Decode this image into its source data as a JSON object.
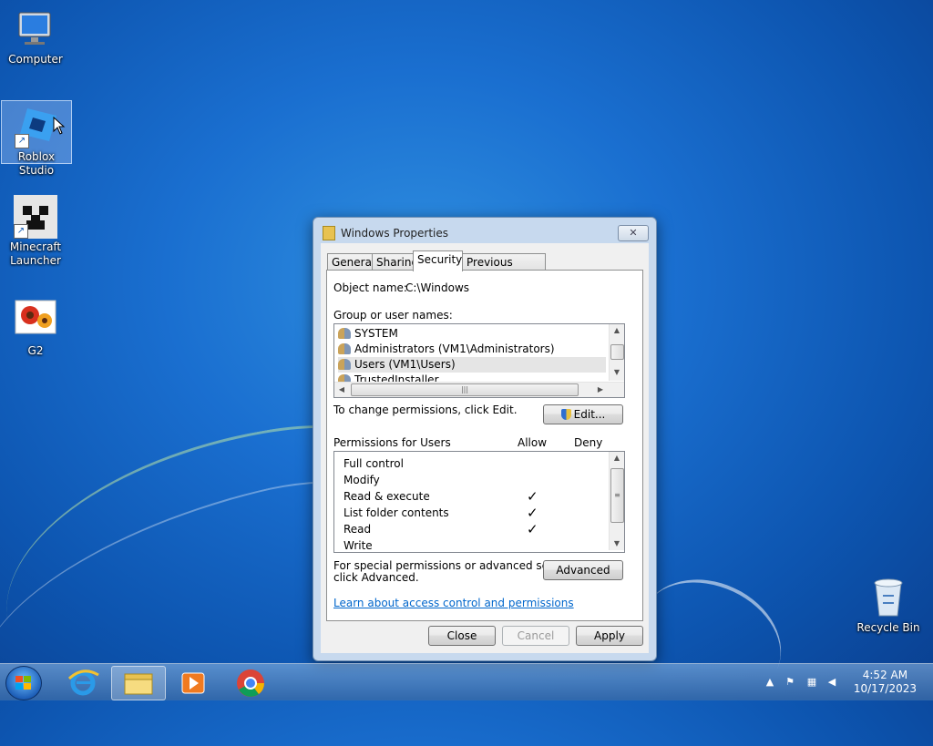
{
  "desktop": {
    "icons": [
      {
        "label": "Computer"
      },
      {
        "label": "Roblox Studio"
      },
      {
        "label": "Minecraft\nLauncher"
      },
      {
        "label": "G2"
      },
      {
        "label": "Recycle Bin"
      }
    ]
  },
  "dialog": {
    "title": "Windows Properties",
    "close_glyph": "✕",
    "tabs": [
      "General",
      "Sharing",
      "Security",
      "Previous Versions"
    ],
    "active_tab": "Security",
    "object_name_label": "Object name:",
    "object_name_value": "C:\\Windows",
    "group_label": "Group or user names:",
    "users": [
      {
        "name": "SYSTEM"
      },
      {
        "name": "Administrators (VM1\\Administrators)"
      },
      {
        "name": "Users (VM1\\Users)",
        "selected": true
      },
      {
        "name": "TrustedInstaller"
      }
    ],
    "change_text": "To change permissions, click Edit.",
    "edit_button": "Edit...",
    "permissions_label": "Permissions for Users",
    "allow_header": "Allow",
    "deny_header": "Deny",
    "permissions": [
      {
        "name": "Full control",
        "allow": false,
        "deny": false
      },
      {
        "name": "Modify",
        "allow": false,
        "deny": false
      },
      {
        "name": "Read & execute",
        "allow": true,
        "deny": false
      },
      {
        "name": "List folder contents",
        "allow": true,
        "deny": false
      },
      {
        "name": "Read",
        "allow": true,
        "deny": false
      },
      {
        "name": "Write",
        "allow": false,
        "deny": false
      }
    ],
    "check_glyph": "✓",
    "special_text_line1": "For special permissions or advanced settings,",
    "special_text_line2": "click Advanced.",
    "advanced_button": "Advanced",
    "learn_link": "Learn about access control and permissions",
    "close_button": "Close",
    "cancel_button": "Cancel",
    "apply_button": "Apply"
  },
  "taskbar": {
    "clock_time": "4:52 AM",
    "clock_date": "10/17/2023",
    "tray_arrow": "▲"
  },
  "colors": {
    "desktop_blue": "#1a6fd0",
    "link_blue": "#0066cc"
  }
}
